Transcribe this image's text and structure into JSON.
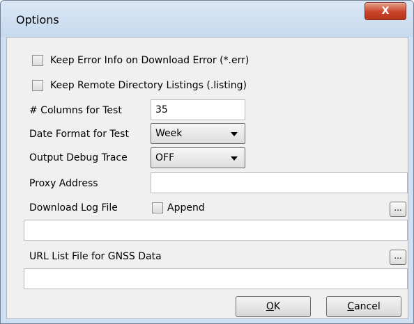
{
  "window": {
    "title": "Options",
    "close_label": "X"
  },
  "checkboxes": [
    {
      "label": "Keep Error Info on Download Error (*.err)",
      "checked": false
    },
    {
      "label": "Keep Remote Directory Listings (.listing)",
      "checked": false
    }
  ],
  "columns": {
    "label": "# Columns for Test",
    "value": "35"
  },
  "date_format": {
    "label": "Date Format for Test",
    "selected": "Week"
  },
  "debug_trace": {
    "label": "Output Debug Trace",
    "selected": "OFF"
  },
  "proxy": {
    "label": "Proxy Address",
    "value": ""
  },
  "download_log": {
    "label": "Download Log File",
    "append_label": "Append",
    "append_checked": false,
    "browse_label": "...",
    "path": ""
  },
  "url_list": {
    "label": "URL List File for GNSS Data",
    "browse_label": "...",
    "path": ""
  },
  "buttons": {
    "ok": "OK",
    "ok_mnemonic": "O",
    "ok_rest": "K",
    "cancel": "Cancel",
    "cancel_mnemonic": "C",
    "cancel_rest": "ancel"
  }
}
